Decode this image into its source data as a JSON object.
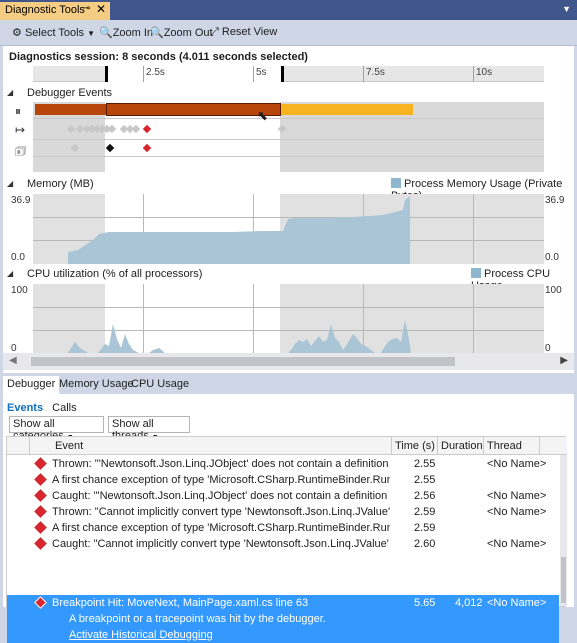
{
  "window": {
    "tab_title": "Diagnostic Tools",
    "pin_glyph": "⊸",
    "close_glyph": "✕"
  },
  "toolbar": {
    "select_tools": "Select Tools",
    "zoom_in": "Zoom In",
    "zoom_out": "Zoom Out",
    "reset_view": "Reset View"
  },
  "session": {
    "text": "Diagnostics session: 8 seconds (4.011 seconds selected)"
  },
  "ruler": {
    "labels": [
      "2.5s",
      "5s",
      "7.5s",
      "10s"
    ]
  },
  "sections": {
    "debugger_events": "Debugger Events",
    "memory": "Memory (MB)",
    "memory_legend": "Process Memory Usage (Private Bytes)",
    "memory_max": "36.9",
    "memory_min": "0.0",
    "cpu": "CPU utilization (% of all processors)",
    "cpu_legend": "Process CPU Usage",
    "cpu_max": "100",
    "cpu_min": "0"
  },
  "colors": {
    "break_bar": "#b8450c",
    "run_bar": "#f7b420",
    "exception": "#d7262e",
    "chart_fill": "#a9c5d6",
    "selection": "#3399ff"
  },
  "lower_tabs": [
    "Debugger",
    "Memory Usage",
    "CPU Usage"
  ],
  "sub_tabs": {
    "events": "Events",
    "calls": "Calls"
  },
  "filters": {
    "categories": "Show all categories",
    "threads": "Show all threads"
  },
  "grid": {
    "headers": {
      "event": "Event",
      "time": "Time (s)",
      "duration": "Duration",
      "thread": "Thread"
    },
    "rows": [
      {
        "event": "Thrown: \"'Newtonsoft.Json.Linq.JObject' does not contain a definition for 'Th...",
        "time": "2.55",
        "duration": "",
        "thread": "<No Name>"
      },
      {
        "event": "A first chance exception of type 'Microsoft.CSharp.RuntimeBinder.RuntimeBin...",
        "time": "2.55",
        "duration": "",
        "thread": ""
      },
      {
        "event": "Caught: \"'Newtonsoft.Json.Linq.JObject' does not contain a definition for 'Thu...",
        "time": "2.56",
        "duration": "",
        "thread": "<No Name>"
      },
      {
        "event": "Thrown: \"Cannot implicitly convert type 'Newtonsoft.Json.Linq.JValue' to 'stri...",
        "time": "2.59",
        "duration": "",
        "thread": "<No Name>"
      },
      {
        "event": "A first chance exception of type 'Microsoft.CSharp.RuntimeBinder.RuntimeBin...",
        "time": "2.59",
        "duration": "",
        "thread": ""
      },
      {
        "event": "Caught: \"Cannot implicitly convert type 'Newtonsoft.Json.Linq.JValue' to 'strin...",
        "time": "2.60",
        "duration": "",
        "thread": "<No Name>"
      }
    ],
    "selected": {
      "event": "Breakpoint Hit: MoveNext, MainPage.xaml.cs line 63",
      "time": "5.65",
      "duration": "4,012",
      "thread": "<No Name>",
      "detail": "A breakpoint or a tracepoint was hit by the debugger.",
      "link": "Activate Historical Debugging"
    }
  }
}
